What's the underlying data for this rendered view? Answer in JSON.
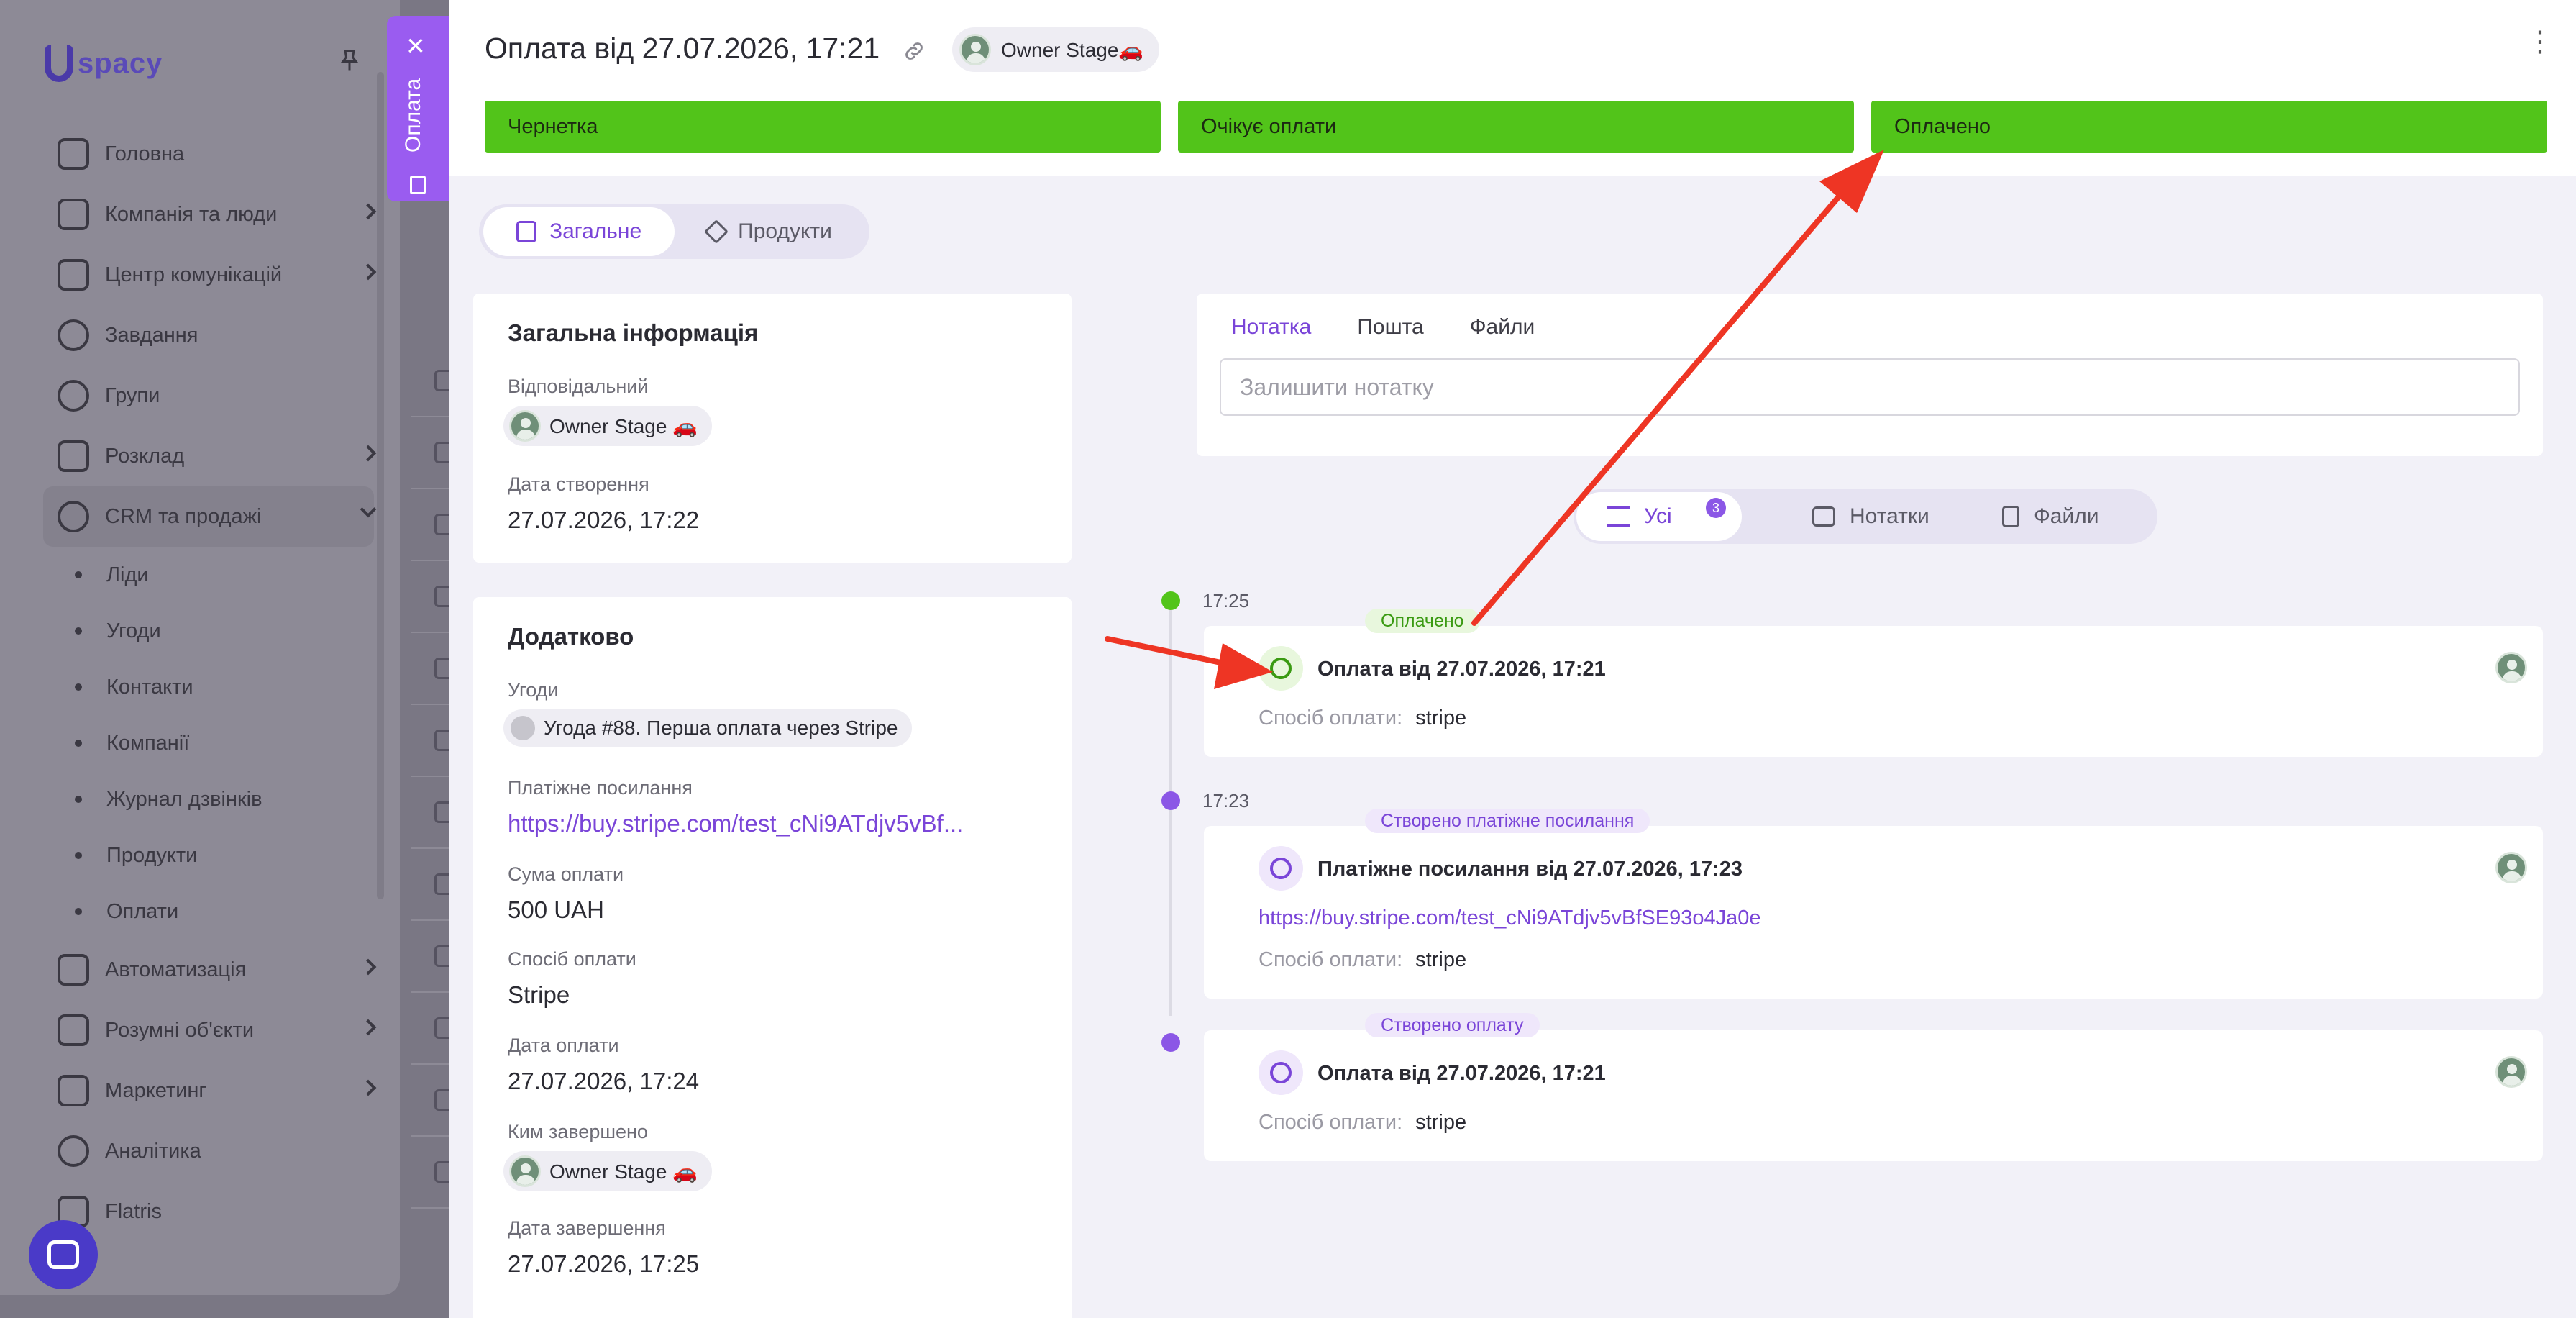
{
  "background_app": {
    "brand": "spacy",
    "nav": [
      {
        "label": "Головна",
        "icon": "home-icon",
        "chevron": false
      },
      {
        "label": "Компанія та люди",
        "icon": "building-icon",
        "chevron": true
      },
      {
        "label": "Центр комунікацій",
        "icon": "chat-icon",
        "chevron": true
      },
      {
        "label": "Завдання",
        "icon": "check-circle-icon",
        "chevron": false
      },
      {
        "label": "Групи",
        "icon": "users-icon",
        "chevron": false
      },
      {
        "label": "Розклад",
        "icon": "calendar-icon",
        "chevron": true
      },
      {
        "label": "CRM та продажі",
        "icon": "database-icon",
        "chevron": true
      }
    ],
    "crm_sub": [
      "Ліди",
      "Угоди",
      "Контакти",
      "Компанії",
      "Журнал дзвінків",
      "Продукти",
      "Оплати"
    ],
    "nav_bottom": [
      {
        "label": "Автоматизація",
        "icon": "bolt-icon",
        "chevron": true
      },
      {
        "label": "Розумні об'єкти",
        "icon": "scan-icon",
        "chevron": true
      },
      {
        "label": "Маркетинг",
        "icon": "megaphone-icon",
        "chevron": true
      },
      {
        "label": "Аналітика",
        "icon": "chart-icon",
        "chevron": false
      },
      {
        "label": "Flatris",
        "icon": "game-icon",
        "chevron": false
      }
    ]
  },
  "vertical_tab": {
    "label": "Оплата"
  },
  "header": {
    "title": "Оплата від 27.07.2026, 17:21",
    "owner": "Owner Stage🚗",
    "stages": [
      "Чернетка",
      "Очікує оплати",
      "Оплачено"
    ],
    "stage_color": "#52c41a"
  },
  "tabs": [
    {
      "label": "Загальне",
      "icon": "document-icon",
      "active": true
    },
    {
      "label": "Продукти",
      "icon": "box-icon",
      "active": false
    }
  ],
  "general": {
    "title": "Загальна інформація",
    "responsible_label": "Відповідальний",
    "responsible": "Owner Stage 🚗",
    "created_label": "Дата створення",
    "created": "27.07.2026, 17:22"
  },
  "extra": {
    "title": "Додатково",
    "deals_label": "Угоди",
    "deal": "Угода #88. Перша оплата через Stripe",
    "pay_link_label": "Платіжне посилання",
    "pay_link": "https://buy.stripe.com/test_cNi9ATdjv5vBf...",
    "amount_label": "Сума оплати",
    "amount": "500 UAH",
    "method_label": "Спосіб оплати",
    "method": "Stripe",
    "pay_date_label": "Дата оплати",
    "pay_date": "27.07.2026, 17:24",
    "completed_by_label": "Ким завершено",
    "completed_by": "Owner Stage 🚗",
    "completed_date_label": "Дата завершення",
    "completed_date": "27.07.2026, 17:25"
  },
  "note": {
    "tabs": [
      "Нотатка",
      "Пошта",
      "Файли"
    ],
    "placeholder": "Залишити нотатку"
  },
  "filter": [
    {
      "label": "Усі",
      "badge": "3",
      "active": true
    },
    {
      "label": "Нотатки",
      "active": false
    },
    {
      "label": "Файли",
      "active": false
    }
  ],
  "timeline": [
    {
      "time": "17:25",
      "dot_color": "#52c41a",
      "tag": "Оплачено",
      "tag_bg": "#e8f7dd",
      "tag_color": "#3a9a12",
      "title": "Оплата від 27.07.2026, 17:21",
      "method_label": "Спосіб оплати:",
      "method": "stripe"
    },
    {
      "time": "17:23",
      "dot_color": "#8b57e6",
      "tag": "Створено платіжне посилання",
      "tag_bg": "#efe7fb",
      "tag_color": "#7a45d8",
      "title": "Платіжне посилання від 27.07.2026, 17:23",
      "link": "https://buy.stripe.com/test_cNi9ATdjv5vBfSE93o4Ja0e",
      "method_label": "Спосіб оплати:",
      "method": "stripe"
    },
    {
      "time": "",
      "dot_color": "#8b57e6",
      "tag": "Створено оплату",
      "tag_bg": "#efe7fb",
      "tag_color": "#7a45d8",
      "title": "Оплата від 27.07.2026, 17:21",
      "method_label": "Спосіб оплати:",
      "method": "stripe"
    }
  ],
  "annotation_color": "#ee3524"
}
